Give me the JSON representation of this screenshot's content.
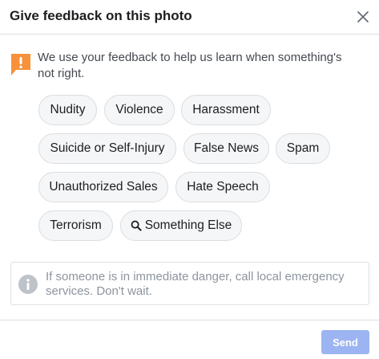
{
  "dialog": {
    "title": "Give feedback on this photo",
    "intro": "We use your feedback to help us learn when something's not right.",
    "options": [
      "Nudity",
      "Violence",
      "Harassment",
      "Suicide or Self-Injury",
      "False News",
      "Spam",
      "Unauthorized Sales",
      "Hate Speech",
      "Terrorism",
      "Something Else"
    ],
    "notice": "If someone is in immediate danger, call local emergency services. Don't wait.",
    "send_label": "Send"
  },
  "icons": {
    "close": "close-icon",
    "warning": "exclamation-icon",
    "search": "search-icon",
    "info": "info-icon"
  },
  "colors": {
    "warning": "#f7923b",
    "chip_bg": "#f5f6f7",
    "send_disabled": "#9cb4f2",
    "info_gray": "#bec3c9"
  }
}
